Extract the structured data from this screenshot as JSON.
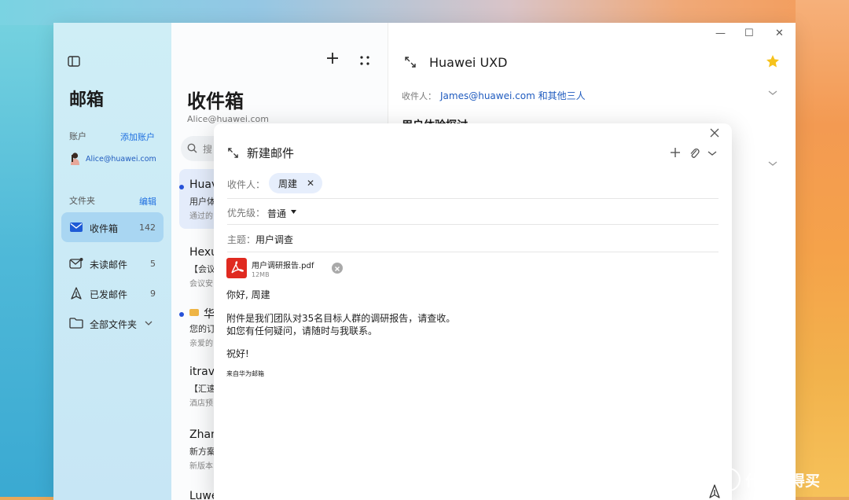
{
  "app": {
    "title": "邮箱",
    "window_controls": {
      "minimize": "—",
      "maximize": "☐",
      "close": "✕"
    }
  },
  "sidebar": {
    "title": "邮箱",
    "account_label": "账户",
    "add_account": "添加账户",
    "account_email": "Alice@huawei.com",
    "folders_label": "文件夹",
    "edit": "编辑",
    "items": [
      {
        "label": "收件箱",
        "count": "142",
        "icon": "mail-icon",
        "active": true
      },
      {
        "label": "未读邮件",
        "count": "5",
        "icon": "unread-mail-icon"
      },
      {
        "label": "已发邮件",
        "count": "9",
        "icon": "sent-icon"
      },
      {
        "label": "全部文件夹",
        "count": "",
        "icon": "folder-icon"
      }
    ]
  },
  "list": {
    "title": "收件箱",
    "account": "Alice@huawei.com",
    "search_placeholder": "搜",
    "messages": [
      {
        "from": "Huav",
        "subject": "用户体",
        "preview": "通过的",
        "unread": true,
        "selected": true
      },
      {
        "from": "Hexu",
        "subject": "【会议",
        "preview": "会议安",
        "unread": false
      },
      {
        "from": "华",
        "subject": "您的订",
        "preview": "亲爱的",
        "unread": true,
        "badge": true
      },
      {
        "from": "itrave",
        "subject": "【汇速",
        "preview": "酒店预",
        "unread": false
      },
      {
        "from": "Zhan",
        "subject": "新方案",
        "preview": "新版本",
        "unread": false
      },
      {
        "from": "Luwe",
        "subject": "",
        "preview": "",
        "unread": false
      }
    ]
  },
  "reader": {
    "title": "Huawei UXD",
    "to_label": "收件人：",
    "to_value": "James@huawei.com 和其他三人",
    "heading": "用户体验探讨"
  },
  "compose": {
    "title": "新建邮件",
    "to_label": "收件人：",
    "recipient": "周建",
    "priority_label": "优先级：",
    "priority_value": "普通",
    "subject_label": "主题：",
    "subject_value": "用户调查",
    "attachment": {
      "name": "用户调研报告.pdf",
      "size": "12MB"
    },
    "body": {
      "greeting": "你好, 周建",
      "line1": "附件是我们团队对35名目标人群的调研报告，请查收。",
      "line2": "如您有任何疑问，请随时与我联系。",
      "closing": "祝好!",
      "signature": "来自华为邮箱"
    }
  },
  "watermark": {
    "text": "什么值得买"
  },
  "colors": {
    "accent": "#1f6fe0",
    "sidebar_active": "#a9d6f2",
    "pdf_red": "#e02a20",
    "star": "#f6c21c"
  }
}
